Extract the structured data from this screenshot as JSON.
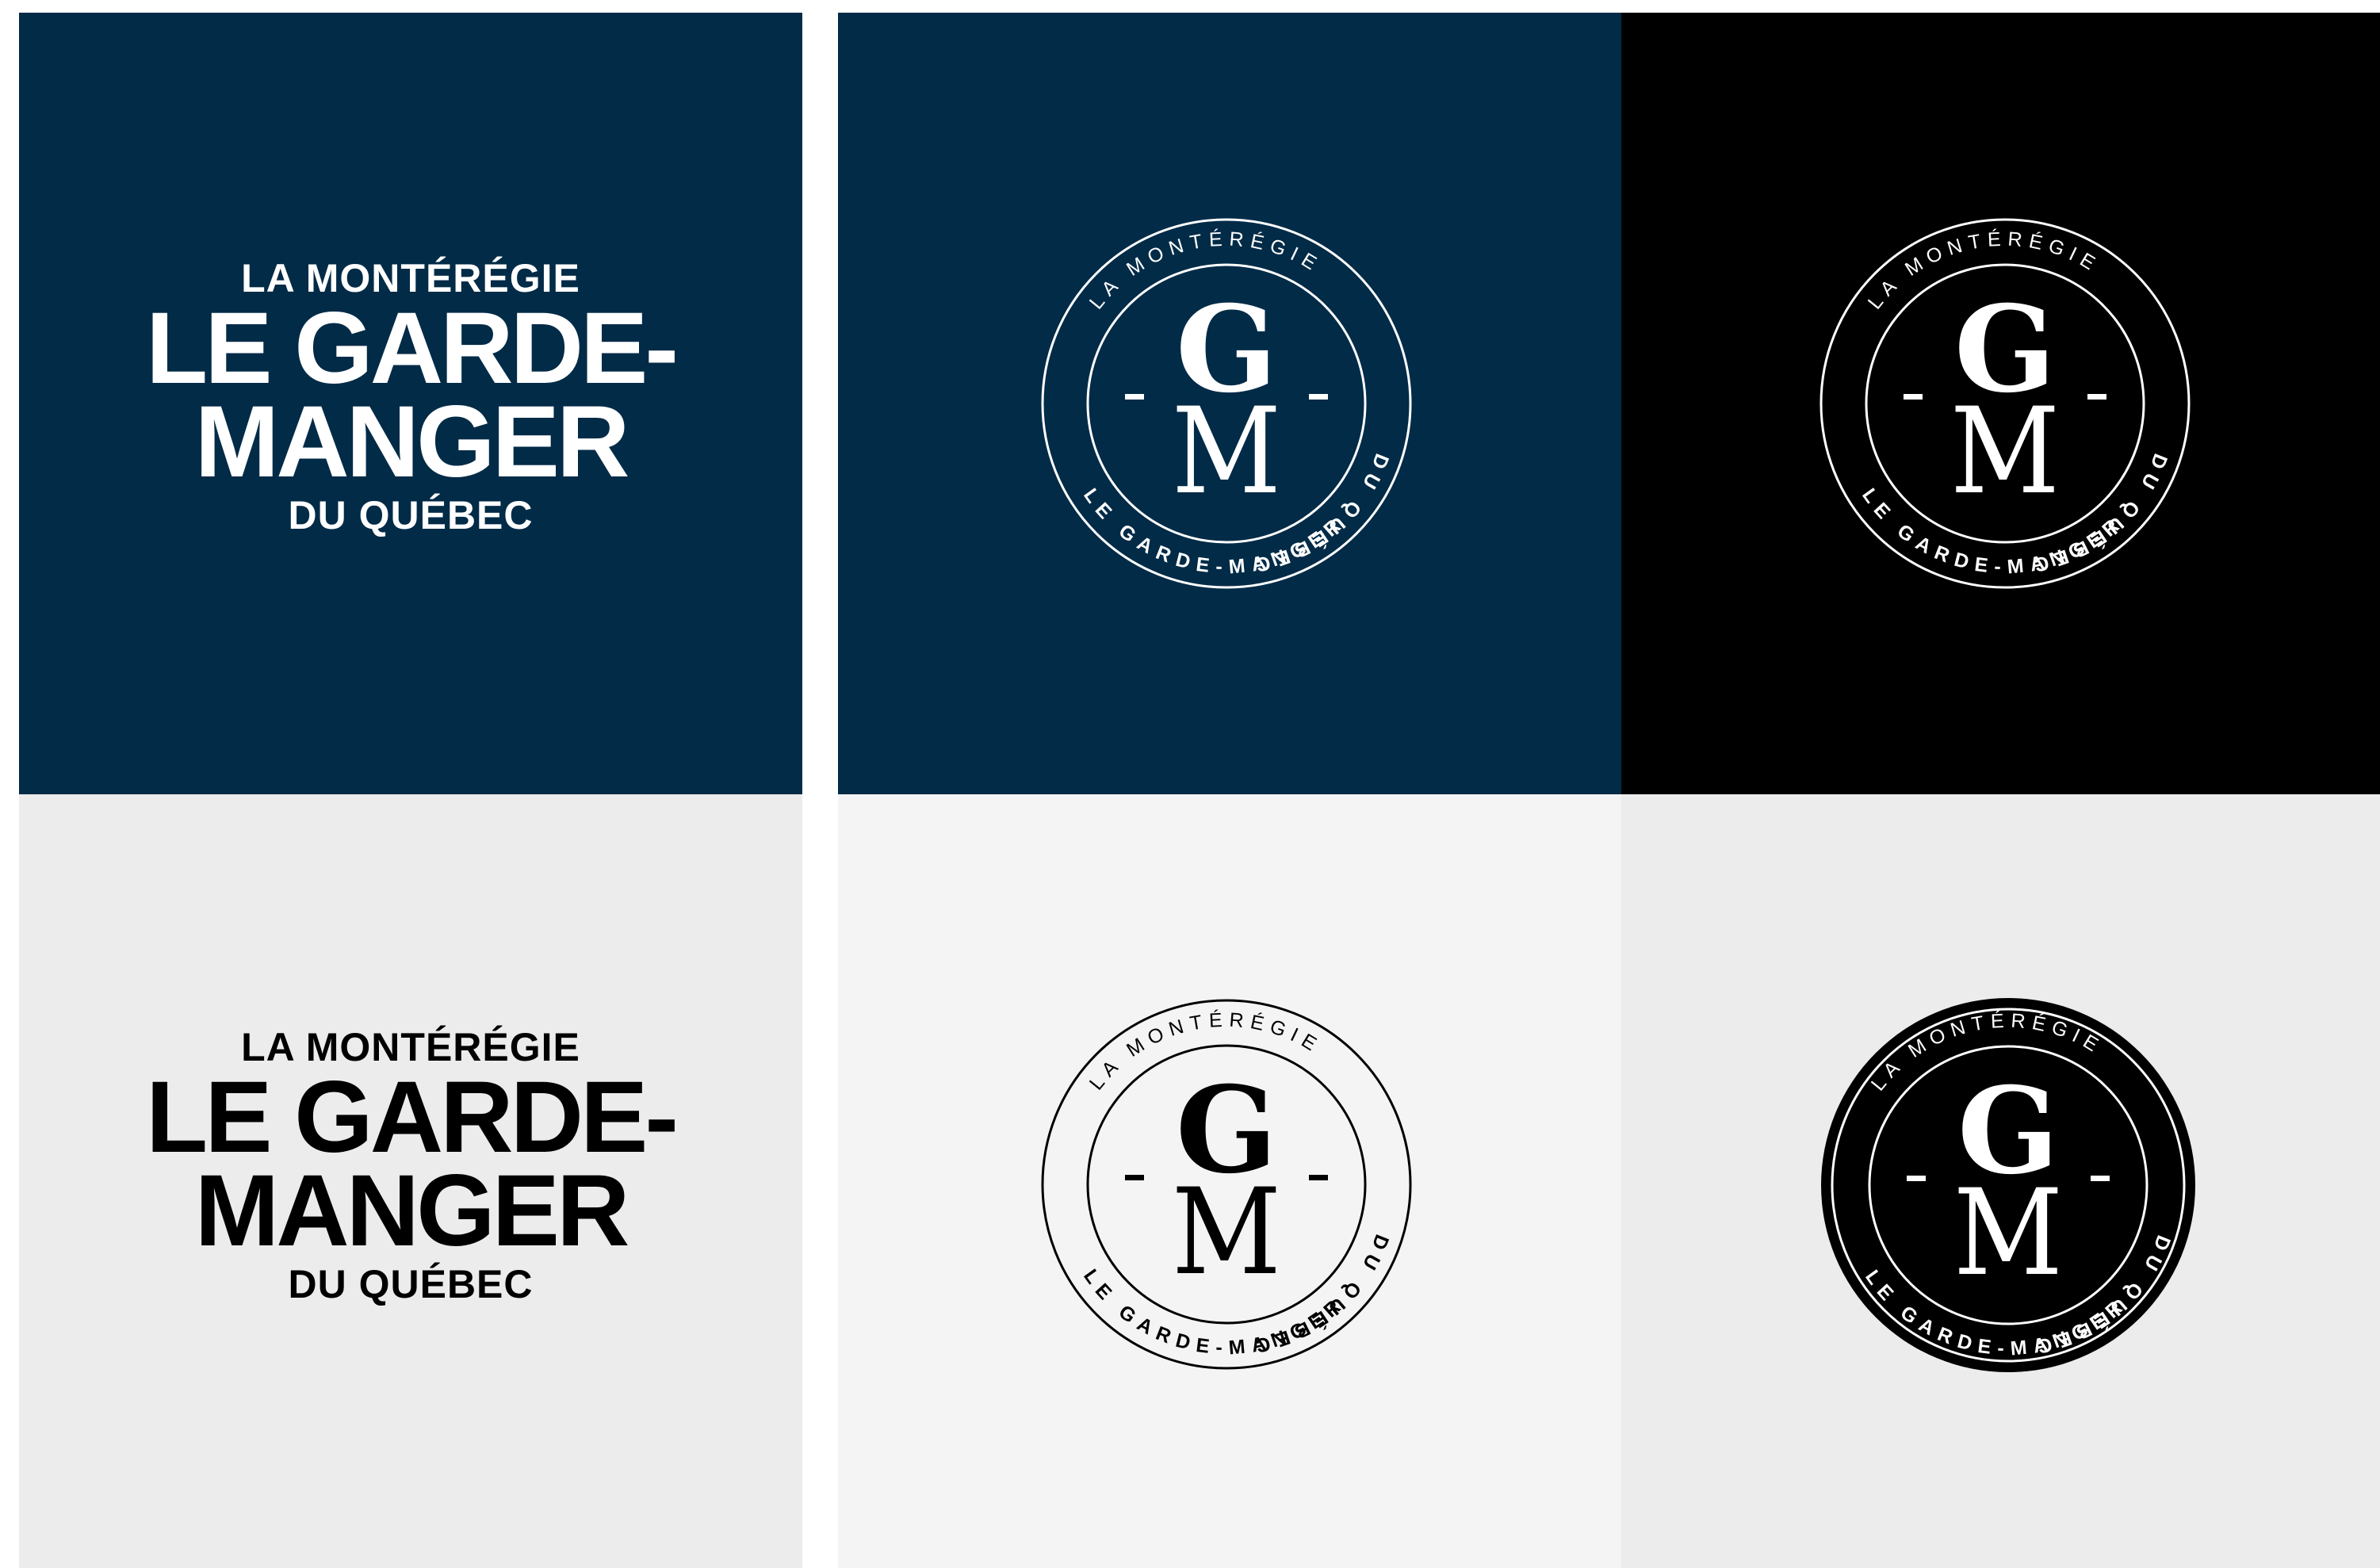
{
  "brand": {
    "region": "LA MONTÉRÉGIE",
    "name_line1": "LE GARDE-",
    "name_line2": "MANGER",
    "locality": "DU QUÉBEC",
    "emblem_top_text": "LA MONTÉRÉGIE",
    "emblem_right_text": "DU QUÉBEC",
    "emblem_bottom_text": "LE GARDE-MANGER",
    "monogram_top": "G",
    "monogram_bottom": "M"
  },
  "colors": {
    "navy": "#022b47",
    "black": "#000000",
    "light_gray": "#ececec",
    "off_white": "#f4f4f4",
    "white": "#ffffff"
  },
  "panels": [
    {
      "id": "top-left",
      "type": "wordmark",
      "background": "navy",
      "ink": "white"
    },
    {
      "id": "top-middle",
      "type": "emblem-outline",
      "background": "navy",
      "ink": "white"
    },
    {
      "id": "top-right",
      "type": "emblem-outline",
      "background": "black",
      "ink": "white"
    },
    {
      "id": "bottom-left",
      "type": "wordmark",
      "background": "light_gray",
      "ink": "black"
    },
    {
      "id": "bottom-middle",
      "type": "emblem-outline",
      "background": "off_white",
      "ink": "black"
    },
    {
      "id": "bottom-right",
      "type": "emblem-solid",
      "background": "light_gray",
      "ink": "white"
    }
  ]
}
